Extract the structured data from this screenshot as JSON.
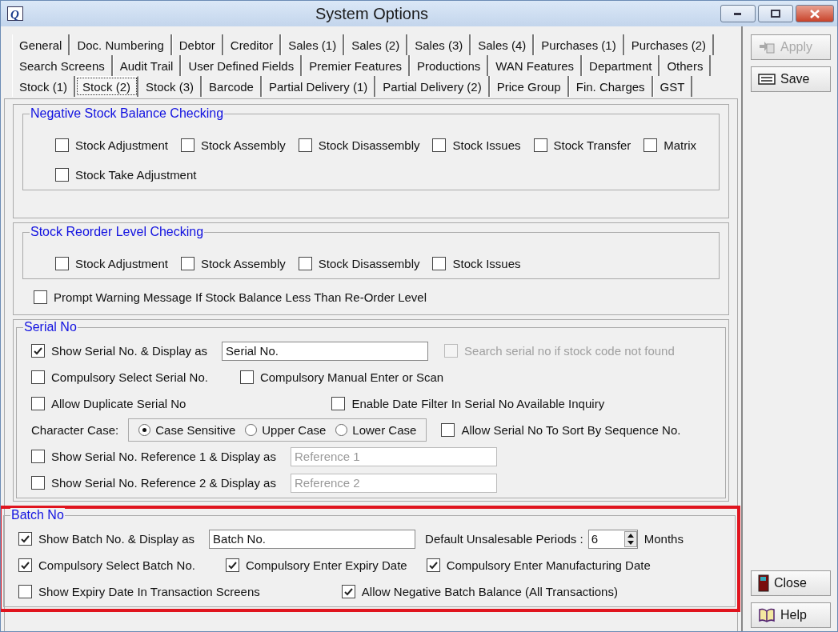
{
  "window": {
    "title": "System Options",
    "logo": "Q"
  },
  "tab_rows": [
    [
      {
        "label": "General",
        "selected": false
      },
      {
        "label": "Doc. Numbering",
        "selected": false
      },
      {
        "label": "Debtor",
        "selected": false
      },
      {
        "label": "Creditor",
        "selected": false
      },
      {
        "label": "Sales (1)",
        "selected": false
      },
      {
        "label": "Sales (2)",
        "selected": false
      },
      {
        "label": "Sales (3)",
        "selected": false
      },
      {
        "label": "Sales (4)",
        "selected": false
      },
      {
        "label": "Purchases (1)",
        "selected": false
      },
      {
        "label": "Purchases (2)",
        "selected": false
      }
    ],
    [
      {
        "label": "Search Screens",
        "selected": false
      },
      {
        "label": "Audit Trail",
        "selected": false
      },
      {
        "label": "User Defined Fields",
        "selected": false
      },
      {
        "label": "Premier Features",
        "selected": false
      },
      {
        "label": "Productions",
        "selected": false
      },
      {
        "label": "WAN Features",
        "selected": false
      },
      {
        "label": "Department",
        "selected": false
      },
      {
        "label": "Others",
        "selected": false
      }
    ],
    [
      {
        "label": "Stock (1)",
        "selected": false
      },
      {
        "label": "Stock (2)",
        "selected": true
      },
      {
        "label": "Stock (3)",
        "selected": false
      },
      {
        "label": "Barcode",
        "selected": false
      },
      {
        "label": "Partial Delivery (1)",
        "selected": false
      },
      {
        "label": "Partial Delivery (2)",
        "selected": false
      },
      {
        "label": "Price Group",
        "selected": false
      },
      {
        "label": "Fin. Charges",
        "selected": false
      },
      {
        "label": "GST",
        "selected": false
      }
    ]
  ],
  "side_buttons": [
    {
      "kind": "apply",
      "label": "Apply",
      "disabled": true
    },
    {
      "kind": "save",
      "label": "Save",
      "disabled": false
    },
    {
      "kind": "close",
      "label": "Close",
      "disabled": false
    },
    {
      "kind": "help",
      "label": "Help",
      "disabled": false
    }
  ],
  "panels": [
    {
      "group": {
        "title": "Negative Stock Balance Checking",
        "rows": [
          [
            {
              "kind": "checkbox",
              "label": "Stock Adjustment",
              "checked": false
            },
            {
              "kind": "checkbox",
              "label": "Stock Assembly",
              "checked": false
            },
            {
              "kind": "checkbox",
              "label": "Stock Disassembly",
              "checked": false
            },
            {
              "kind": "checkbox",
              "label": "Stock Issues",
              "checked": false
            },
            {
              "kind": "checkbox",
              "label": "Stock Transfer",
              "checked": false
            },
            {
              "kind": "checkbox",
              "label": "Matrix",
              "checked": false
            }
          ],
          [
            {
              "kind": "checkbox",
              "label": "Stock Take Adjustment",
              "checked": false
            }
          ]
        ]
      },
      "highlighted": false
    },
    {
      "group": {
        "title": "Stock Reorder Level Checking",
        "rows": [
          [
            {
              "kind": "checkbox",
              "label": "Stock Adjustment",
              "checked": false
            },
            {
              "kind": "checkbox",
              "label": "Stock Assembly",
              "checked": false
            },
            {
              "kind": "checkbox",
              "label": "Stock Disassembly",
              "checked": false
            },
            {
              "kind": "checkbox",
              "label": "Stock Issues",
              "checked": false
            }
          ]
        ]
      },
      "rows": [
        [
          {
            "kind": "checkbox",
            "label": "Prompt Warning Message If Stock Balance Less Than Re-Order Level",
            "checked": false
          }
        ]
      ],
      "highlighted": false
    },
    {
      "title": "Serial No",
      "highlighted": false,
      "rows": [
        [
          {
            "kind": "checkbox",
            "label": "Show Serial No. & Display as",
            "checked": true
          },
          {
            "kind": "field",
            "value": "Serial No.",
            "disabled": false
          },
          {
            "kind": "checkbox",
            "label": "Search serial no if stock code not found",
            "checked": false,
            "disabled": true
          }
        ],
        [
          {
            "kind": "checkbox",
            "label": "Compulsory Select Serial No.",
            "checked": false
          },
          {
            "kind": "checkbox",
            "label": "Compulsory Manual Enter or Scan",
            "checked": false
          }
        ],
        [
          {
            "kind": "checkbox",
            "label": "Allow Duplicate Serial No",
            "checked": false
          },
          {
            "kind": "checkbox",
            "label": "Enable Date Filter In Serial No Available Inquiry",
            "checked": false
          }
        ],
        [
          {
            "kind": "label",
            "text": "Character Case:"
          },
          {
            "kind": "radio_group",
            "options": [
              {
                "label": "Case Sensitive",
                "selected": true
              },
              {
                "label": "Upper Case",
                "selected": false
              },
              {
                "label": "Lower Case",
                "selected": false
              }
            ]
          },
          {
            "kind": "checkbox",
            "label": "Allow Serial No To Sort By Sequence No.",
            "checked": false
          }
        ],
        [
          {
            "kind": "checkbox",
            "label": "Show Serial No. Reference 1 & Display as",
            "checked": false
          },
          {
            "kind": "field",
            "value": "Reference 1",
            "disabled": true
          }
        ],
        [
          {
            "kind": "checkbox",
            "label": "Show Serial No. Reference 2 & Display as",
            "checked": false
          },
          {
            "kind": "field",
            "value": "Reference 2",
            "disabled": true
          }
        ]
      ]
    },
    {
      "title": "Batch No",
      "highlighted": true,
      "rows": [
        [
          {
            "kind": "checkbox",
            "label": "Show Batch No. & Display as",
            "checked": true
          },
          {
            "kind": "field",
            "value": "Batch No.",
            "disabled": false
          },
          {
            "kind": "label",
            "text": "Default Unsalesable Periods :"
          },
          {
            "kind": "spinner",
            "value": "6"
          },
          {
            "kind": "label",
            "text": "Months"
          }
        ],
        [
          {
            "kind": "checkbox",
            "label": "Compulsory Select Batch No.",
            "checked": true
          },
          {
            "kind": "checkbox",
            "label": "Compulsory Enter Expiry Date",
            "checked": true
          },
          {
            "kind": "checkbox",
            "label": "Compulsory Enter Manufacturing Date",
            "checked": true
          }
        ],
        [
          {
            "kind": "checkbox",
            "label": "Show Expiry Date In Transaction Screens",
            "checked": false
          },
          {
            "kind": "checkbox",
            "label": "Allow Negative Batch Balance (All Transactions)",
            "checked": true
          }
        ]
      ]
    }
  ]
}
